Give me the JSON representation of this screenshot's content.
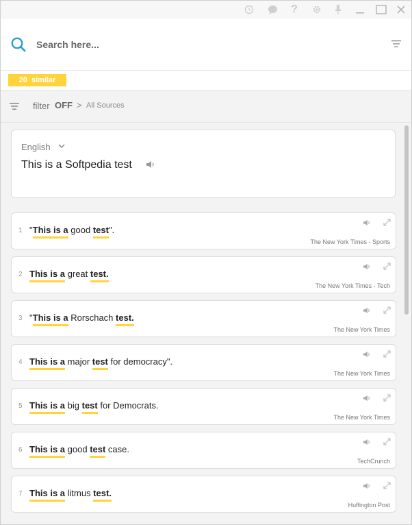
{
  "window": {
    "controls": [
      "history-icon",
      "chat-icon",
      "help-icon",
      "settings-icon",
      "pin-icon",
      "minimize-icon",
      "maximize-icon",
      "close-icon"
    ]
  },
  "search": {
    "placeholder": "Search here..."
  },
  "similar": {
    "count": "20",
    "label": "similar"
  },
  "filter": {
    "label": "filter",
    "state": "OFF",
    "chevron": ">",
    "sources": "All Sources"
  },
  "source": {
    "language": "English",
    "text": "This is a Softpedia test"
  },
  "results": [
    {
      "num": "1",
      "segments": [
        [
          "\"",
          false
        ],
        [
          "This is a",
          true
        ],
        [
          " good ",
          false
        ],
        [
          "test",
          true
        ],
        [
          "\".",
          false
        ]
      ],
      "source": "The New York Times - Sports"
    },
    {
      "num": "2",
      "segments": [
        [
          "This is a",
          true
        ],
        [
          " great ",
          false
        ],
        [
          "test.",
          true
        ]
      ],
      "source": "The New York Times - Tech"
    },
    {
      "num": "3",
      "segments": [
        [
          "\"",
          false
        ],
        [
          "This is a",
          true
        ],
        [
          " Rorschach ",
          false
        ],
        [
          "test.",
          true
        ]
      ],
      "source": "The New York Times"
    },
    {
      "num": "4",
      "segments": [
        [
          "This is a",
          true
        ],
        [
          " major ",
          false
        ],
        [
          "test",
          true
        ],
        [
          " for democracy\".",
          false
        ]
      ],
      "source": "The New York Times"
    },
    {
      "num": "5",
      "segments": [
        [
          "This is a",
          true
        ],
        [
          " big ",
          false
        ],
        [
          "test",
          true
        ],
        [
          " for Democrats.",
          false
        ]
      ],
      "source": "The New York Times"
    },
    {
      "num": "6",
      "segments": [
        [
          "This is a",
          true
        ],
        [
          " good ",
          false
        ],
        [
          "test",
          true
        ],
        [
          " case.",
          false
        ]
      ],
      "source": "TechCrunch"
    },
    {
      "num": "7",
      "segments": [
        [
          "This is a",
          true
        ],
        [
          " litmus ",
          false
        ],
        [
          "test.",
          true
        ]
      ],
      "source": "Huffington Post"
    }
  ],
  "colors": {
    "accent": "#ffd43b",
    "search_icon": "#2b9bd8"
  }
}
